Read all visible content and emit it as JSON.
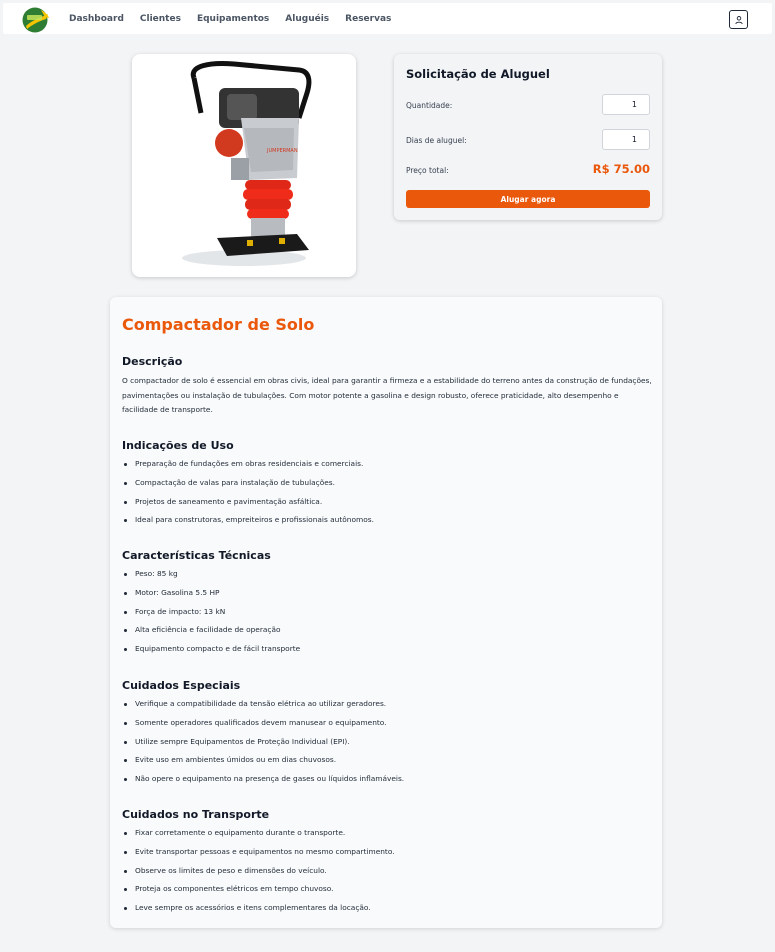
{
  "nav": {
    "logo_alt": "logo",
    "links": [
      "Dashboard",
      "Clientes",
      "Equipamentos",
      "Aluguéis",
      "Reservas"
    ]
  },
  "rent": {
    "title": "Solicitação de Aluguel",
    "quantity_label": "Quantidade:",
    "quantity_value": "1",
    "days_label": "Dias de aluguel:",
    "days_value": "1",
    "price_label": "Preço total:",
    "price_value": "R$ 75.00",
    "button_label": "Alugar agora"
  },
  "product": {
    "title": "Compactador de Solo",
    "description_title": "Descrição",
    "description": "O compactador de solo é essencial em obras civis, ideal para garantir a firmeza e a estabilidade do terreno antes da construção de fundações, pavimentações ou instalação de tubulações. Com motor potente a gasolina e design robusto, oferece praticidade, alto desempenho e facilidade de transporte.",
    "usage_title": "Indicações de Uso",
    "usage": [
      "Preparação de fundações em obras residenciais e comerciais.",
      "Compactação de valas para instalação de tubulações.",
      "Projetos de saneamento e pavimentação asfáltica.",
      "Ideal para construtoras, empreiteiros e profissionais autônomos."
    ],
    "specs_title": "Características Técnicas",
    "specs": [
      "Peso: 85 kg",
      "Motor: Gasolina 5.5 HP",
      "Força de impacto: 13 kN",
      "Alta eficiência e facilidade de operação",
      "Equipamento compacto e de fácil transporte"
    ],
    "care_title": "Cuidados Especiais",
    "care": [
      "Verifique a compatibilidade da tensão elétrica ao utilizar geradores.",
      "Somente operadores qualificados devem manusear o equipamento.",
      "Utilize sempre Equipamentos de Proteção Individual (EPI).",
      "Evite uso em ambientes úmidos ou em dias chuvosos.",
      "Não opere o equipamento na presença de gases ou líquidos inflamáveis."
    ],
    "transport_title": "Cuidados no Transporte",
    "transport": [
      "Fixar corretamente o equipamento durante o transporte.",
      "Evite transportar pessoas e equipamentos no mesmo compartimento.",
      "Observe os limites de peso e dimensões do veículo.",
      "Proteja os componentes elétricos em tempo chuvoso.",
      "Leve sempre os acessórios e itens complementares da locação."
    ]
  },
  "colors": {
    "accent": "#ea580c",
    "background": "#f3f4f6"
  },
  "icons": {
    "user": "user-icon",
    "logo": "logo-icon"
  }
}
